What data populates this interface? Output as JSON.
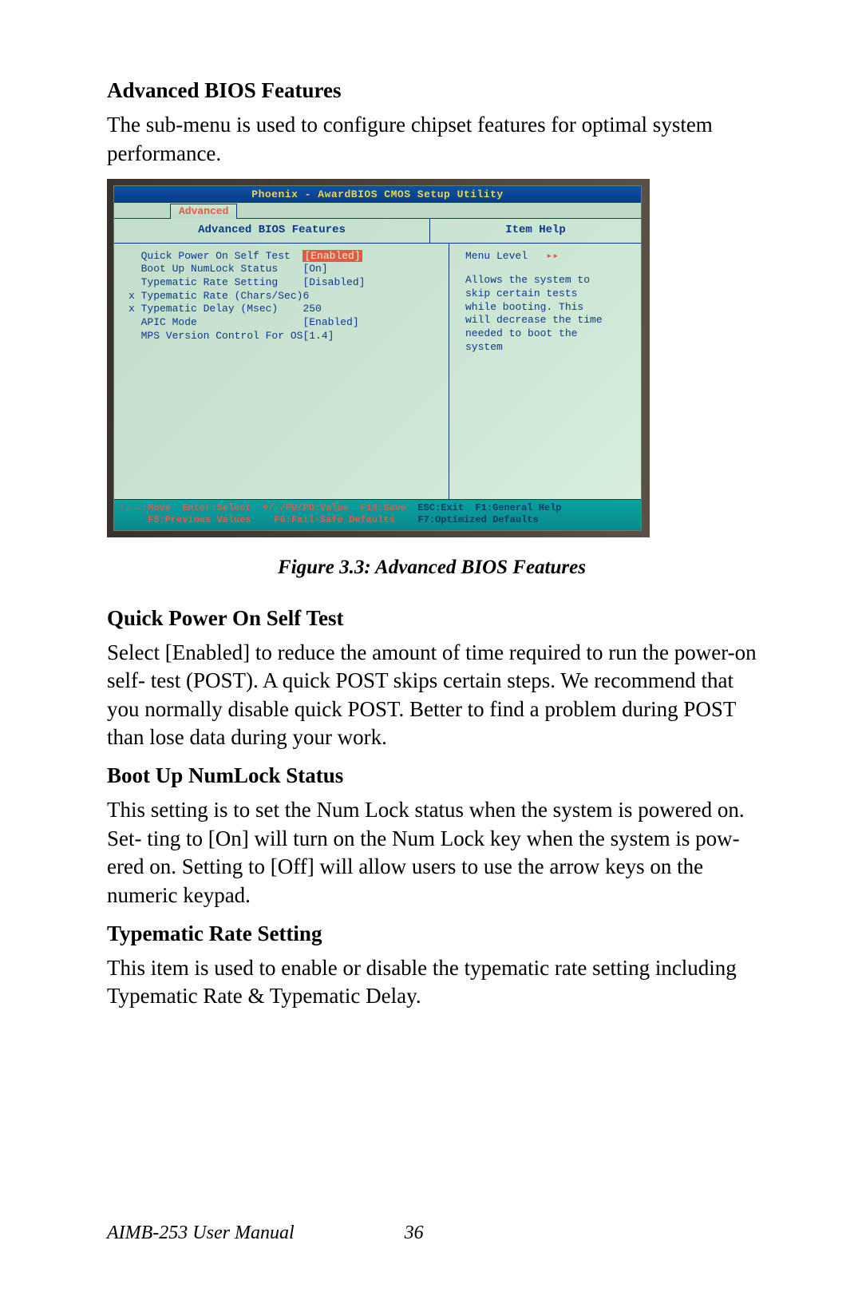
{
  "sections": {
    "adv_title": "Advanced BIOS Features",
    "adv_intro": "The sub-menu is used to configure chipset features for optimal system performance.",
    "qpost_title": "Quick Power On Self Test",
    "qpost_body": "Select [Enabled] to reduce the amount of time required to run the power-on self- test (POST). A quick POST skips certain steps. We recommend that you normally disable quick POST. Better to find a problem during POST than lose data during your work.",
    "numlock_title": "Boot Up NumLock Status",
    "numlock_body": "This setting is to set the Num Lock status when the system is powered on. Set- ting to [On] will turn on the Num Lock key when the system is pow-ered on. Setting to [Off] will allow users to use the arrow keys on the numeric keypad.",
    "type_title": "Typematic Rate Setting",
    "type_body": "This item is used to enable or disable the typematic rate setting including Typematic Rate & Typematic Delay."
  },
  "figure_caption": "Figure 3.3: Advanced BIOS Features",
  "bios": {
    "titlebar": "Phoenix - AwardBIOS CMOS Setup Utility",
    "tab": "Advanced",
    "header_main": "Advanced BIOS Features",
    "header_help": "Item Help",
    "rows": [
      {
        "prefix": "  ",
        "label": "Quick Power On Self Test",
        "value": "[Enabled]",
        "highlight": true
      },
      {
        "prefix": "  ",
        "label": "Boot Up NumLock Status",
        "value": "[On]",
        "highlight": false
      },
      {
        "prefix": "  ",
        "label": "Typematic Rate Setting",
        "value": "[Disabled]",
        "highlight": false
      },
      {
        "prefix": "x ",
        "label": "Typematic Rate (Chars/Sec)",
        "value": "6",
        "highlight": false,
        "dim": true
      },
      {
        "prefix": "x ",
        "label": "Typematic Delay (Msec)",
        "value": "250",
        "highlight": false,
        "dim": true
      },
      {
        "prefix": "  ",
        "label": "APIC Mode",
        "value": "[Enabled]",
        "highlight": false
      },
      {
        "prefix": "  ",
        "label": "MPS Version Control For OS",
        "value": "[1.4]",
        "highlight": false
      }
    ],
    "help": {
      "level_label": "Menu Level",
      "level_arrows": "▸▸",
      "text": "Allows the system to skip certain tests while booting. This will decrease the time needed to boot the system"
    },
    "footer_line1_left": "↑↓→←:Move  Enter:Select  +/-/PU/PD:Value  F10:Save",
    "footer_line1_right": "  ESC:Exit  F1:General Help",
    "footer_line2_left": "     F5:Previous Values    F6:Fail-Safe Defaults",
    "footer_line2_right": "    F7:Optimized Defaults"
  },
  "page_footer": {
    "manual": "AIMB-253 User Manual",
    "page": "36"
  }
}
